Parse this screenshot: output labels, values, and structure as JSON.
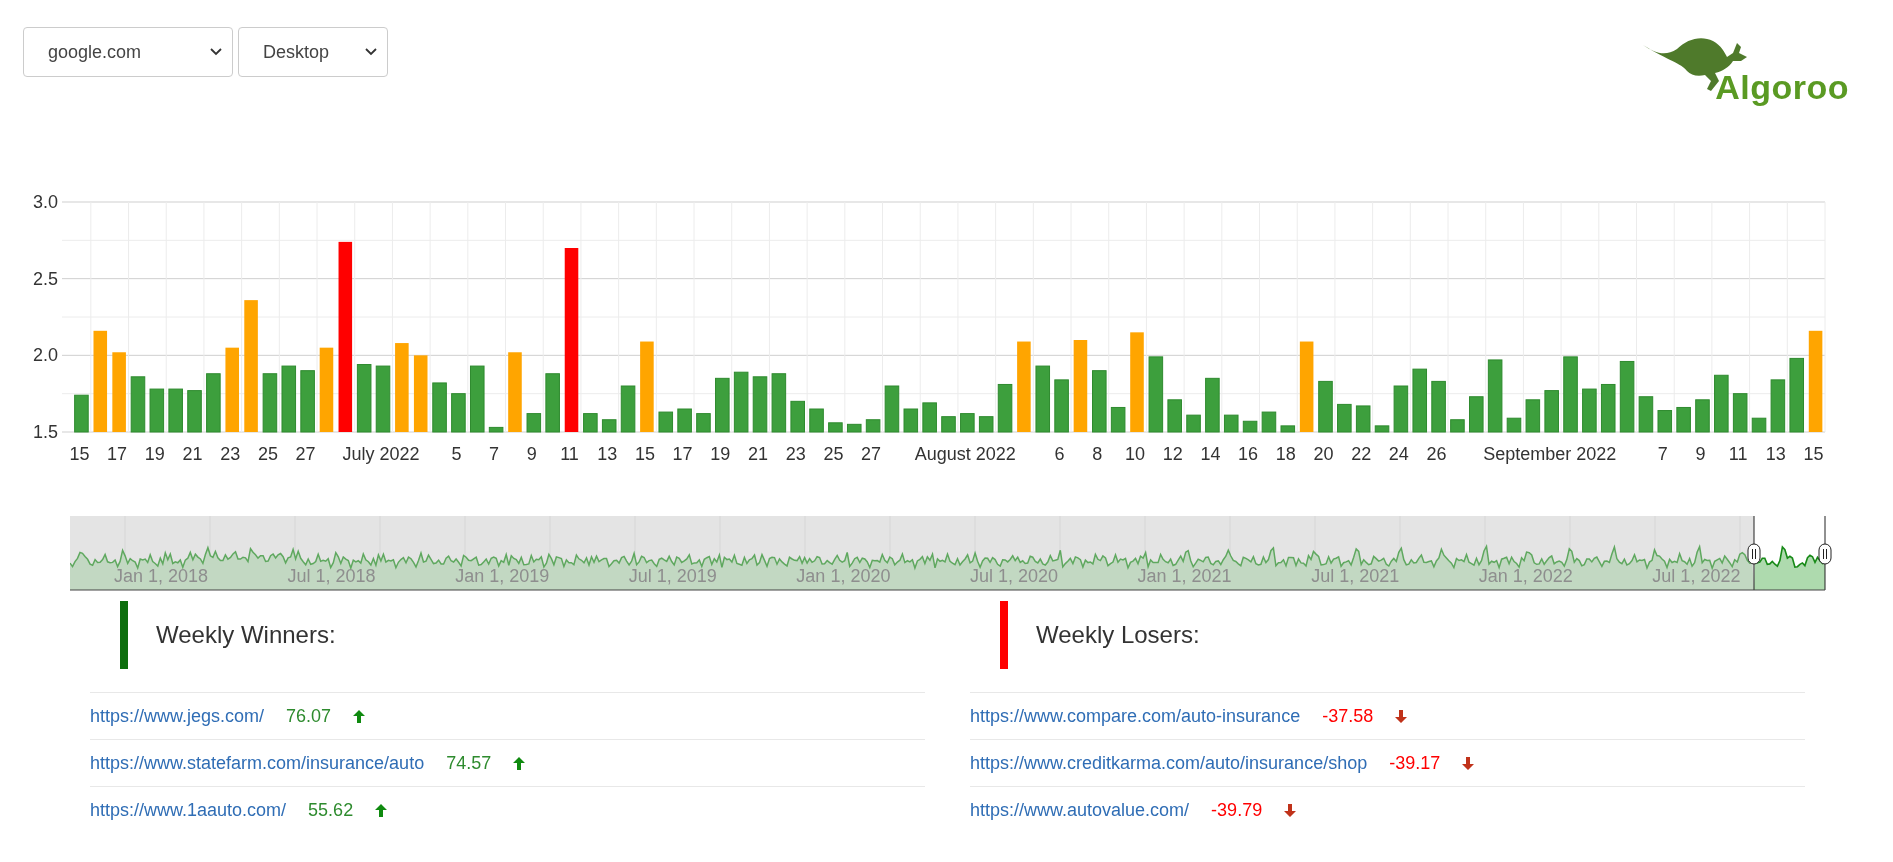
{
  "filters": [
    {
      "value": "google.com"
    },
    {
      "value": "Desktop"
    }
  ],
  "logo": {
    "text": "Algoroo"
  },
  "chart": {
    "chart_data": {
      "type": "bar",
      "grid": true,
      "categories": [
        "15",
        null,
        "17",
        null,
        "19",
        null,
        "21",
        null,
        "23",
        null,
        "25",
        null,
        "27",
        null,
        null,
        null,
        "July 2022",
        null,
        null,
        null,
        "5",
        null,
        "7",
        null,
        "9",
        null,
        "11",
        null,
        "13",
        null,
        "15",
        null,
        "17",
        null,
        "19",
        null,
        "21",
        null,
        "23",
        null,
        "25",
        null,
        "27",
        null,
        null,
        null,
        null,
        "August 2022",
        null,
        null,
        null,
        null,
        "6",
        null,
        "8",
        null,
        "10",
        null,
        "12",
        null,
        "14",
        null,
        "16",
        null,
        "18",
        null,
        "20",
        null,
        "22",
        null,
        "24",
        null,
        "26",
        null,
        null,
        null,
        null,
        null,
        "September 2022",
        null,
        null,
        null,
        null,
        null,
        "7",
        null,
        "9",
        null,
        "11",
        null,
        "13",
        null,
        "15"
      ],
      "series": [
        {
          "color": "#3d9f3d",
          "values": [
            1.74,
            null,
            null,
            1.86,
            1.78,
            1.78,
            1.77,
            1.88,
            null,
            null,
            1.88,
            1.93,
            1.9,
            null,
            null,
            1.94,
            1.93,
            null,
            null,
            1.82,
            1.75,
            1.93,
            1.53,
            null,
            1.62,
            1.88,
            null,
            1.62,
            1.58,
            1.8,
            null,
            1.63,
            1.65,
            1.62,
            1.85,
            1.89,
            1.86,
            1.88,
            1.7,
            1.65,
            1.56,
            1.55,
            1.58,
            1.8,
            1.65,
            1.69,
            1.6,
            1.62,
            1.6,
            1.81,
            null,
            1.93,
            1.84,
            null,
            1.9,
            1.66,
            null,
            1.99,
            1.71,
            1.61,
            1.85,
            1.61,
            1.57,
            1.63,
            1.54,
            null,
            1.83,
            1.68,
            1.67,
            1.54,
            1.8,
            1.91,
            1.83,
            1.58,
            1.73,
            1.97,
            1.59,
            1.71,
            1.77,
            1.99,
            1.78,
            1.81,
            1.96,
            1.73,
            1.64,
            1.66,
            1.71,
            1.87,
            1.75,
            1.59,
            1.84,
            1.98,
            null
          ]
        },
        {
          "color": "#ffa500",
          "values": [
            null,
            2.16,
            2.02,
            null,
            null,
            null,
            null,
            null,
            2.05,
            2.36,
            null,
            null,
            null,
            2.05,
            null,
            null,
            null,
            2.08,
            2.0,
            null,
            null,
            null,
            null,
            2.02,
            null,
            null,
            null,
            null,
            null,
            null,
            2.09,
            null,
            null,
            null,
            null,
            null,
            null,
            null,
            null,
            null,
            null,
            null,
            null,
            null,
            null,
            null,
            null,
            null,
            null,
            null,
            2.09,
            null,
            null,
            2.1,
            null,
            null,
            2.15,
            null,
            null,
            null,
            null,
            null,
            null,
            null,
            null,
            2.09,
            null,
            null,
            null,
            null,
            null,
            null,
            null,
            null,
            null,
            null,
            null,
            null,
            null,
            null,
            null,
            null,
            null,
            null,
            null,
            null,
            null,
            null,
            null,
            null,
            null,
            null,
            2.16
          ]
        },
        {
          "color": "#ff0000",
          "values": [
            null,
            null,
            null,
            null,
            null,
            null,
            null,
            null,
            null,
            null,
            null,
            null,
            null,
            null,
            2.74,
            null,
            null,
            null,
            null,
            null,
            null,
            null,
            null,
            null,
            null,
            null,
            2.7,
            null,
            null,
            null,
            null,
            null,
            null,
            null,
            null,
            null,
            null,
            null,
            null,
            null,
            null,
            null,
            null,
            null,
            null,
            null,
            null,
            null,
            null,
            null,
            null,
            null,
            null,
            null,
            null,
            null,
            null,
            null,
            null,
            null,
            null,
            null,
            null,
            null,
            null,
            null,
            null,
            null,
            null,
            null,
            null,
            null,
            null,
            null,
            null,
            null,
            null,
            null,
            null,
            null,
            null,
            null,
            null,
            null,
            null,
            null,
            null,
            null,
            null,
            null,
            null,
            null,
            null
          ]
        }
      ],
      "ylim": [
        1.5,
        3.0
      ],
      "yticks": [
        {
          "value": 1.5,
          "label": "1.5"
        },
        {
          "value": 2.0,
          "label": "2.0"
        },
        {
          "value": 2.5,
          "label": "2.5"
        },
        {
          "value": 3.0,
          "label": "3.0"
        }
      ]
    }
  },
  "navigator": {
    "labels": [
      "Jan 1, 2018",
      "Jul 1, 2018",
      "Jan 1, 2019",
      "Jul 1, 2019",
      "Jan 1, 2020",
      "Jul 1, 2020",
      "Jan 1, 2021",
      "Jul 1, 2021",
      "Jan 1, 2022",
      "Jul 1, 2022"
    ]
  },
  "lists": [
    {
      "kind": "winners",
      "title": "Weekly Winners:",
      "items": [
        {
          "url": "https://www.jegs.com/",
          "score": "76.07"
        },
        {
          "url": "https://www.statefarm.com/insurance/auto",
          "score": "74.57"
        },
        {
          "url": "https://www.1aauto.com/",
          "score": "55.62"
        }
      ]
    },
    {
      "kind": "losers",
      "title": "Weekly Losers:",
      "items": [
        {
          "url": "https://www.compare.com/auto-insurance",
          "score": "-37.58"
        },
        {
          "url": "https://www.creditkarma.com/auto/insurance/shop",
          "score": "-39.17"
        },
        {
          "url": "https://www.autovalue.com/",
          "score": "-39.79"
        }
      ]
    }
  ]
}
